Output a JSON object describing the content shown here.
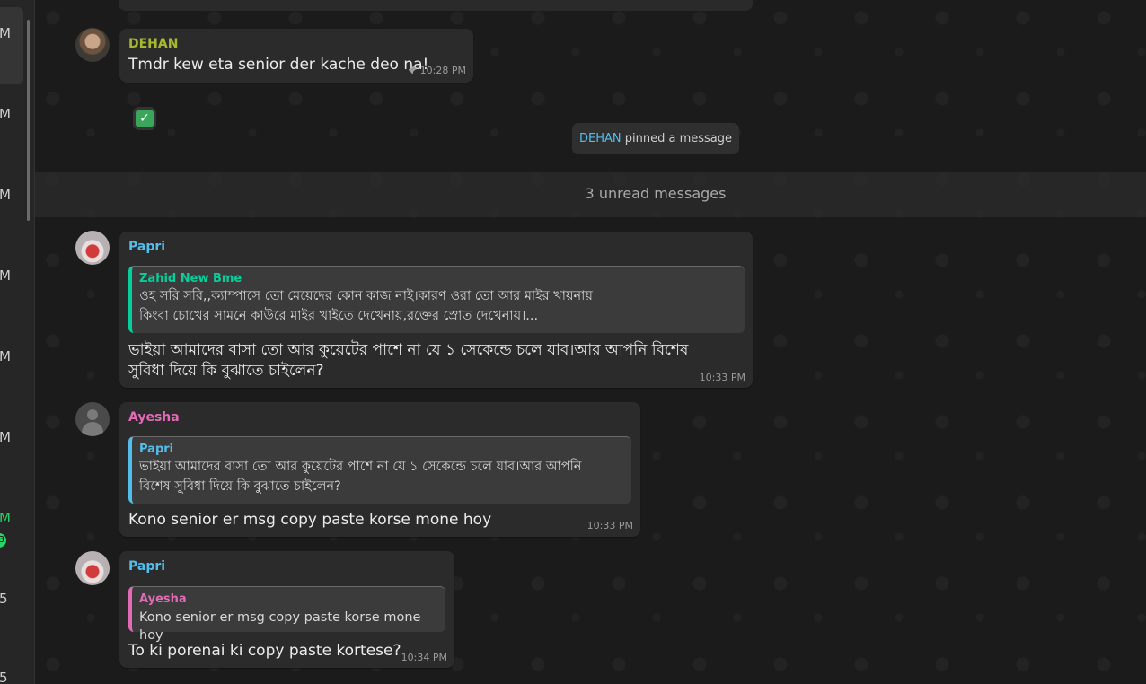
{
  "sidebar": {
    "fragments": [
      "M",
      "M",
      "M",
      "M",
      "M",
      "M",
      "M",
      "5",
      "5"
    ],
    "badge": "3"
  },
  "messages": {
    "dehan": {
      "sender": "DEHAN",
      "sender_color": "#a8b82e",
      "text": "Tmdr kew eta senior der kache deo na!",
      "time": "10:28 PM",
      "reaction": "✓"
    },
    "system_pin": {
      "who": "DEHAN",
      "action": "pinned a message"
    },
    "unread": "3 unread messages",
    "papri1": {
      "sender": "Papri",
      "sender_color": "#53bdeb",
      "quote_sender": "Zahid New Bme",
      "quote_sender_color": "#06cf9c",
      "quote_line1": "ওহ সরি সরি,,ক্যাম্পাসে তো মেয়েদের কোন কাজ নাই।কারণ ওরা তো আর মাইর খায়নায়",
      "quote_line2": "কিংবা চোখের সামনে কাউরে মাইর খাইতে দেখেনায়,রক্তের স্রোত দেখেনায়।...",
      "text_line1": "ভাইয়া আমাদের বাসা তো আর কুয়েটের পাশে না যে ১ সেকেন্ডে চলে যাব।আর আপনি বিশেষ",
      "text_line2": "সুবিধা দিয়ে কি বুঝাতে চাইলেন?",
      "time": "10:33 PM"
    },
    "ayesha": {
      "sender": "Ayesha",
      "sender_color": "#e26ab6",
      "quote_sender": "Papri",
      "quote_sender_color": "#53bdeb",
      "quote_line1": "ভাইয়া আমাদের বাসা তো আর কুয়েটের পাশে না যে ১ সেকেন্ডে চলে যাব।আর আপনি",
      "quote_line2": "বিশেষ সুবিধা দিয়ে কি বুঝাতে চাইলেন?",
      "text": "Kono senior er msg copy paste korse mone hoy",
      "time": "10:33 PM"
    },
    "papri2": {
      "sender": "Papri",
      "sender_color": "#53bdeb",
      "quote_sender": "Ayesha",
      "quote_sender_color": "#e26ab6",
      "quote_text": "Kono senior er msg copy paste korse mone hoy",
      "text": "To ki porenai ki copy paste kortese?",
      "time": "10:34 PM"
    }
  }
}
